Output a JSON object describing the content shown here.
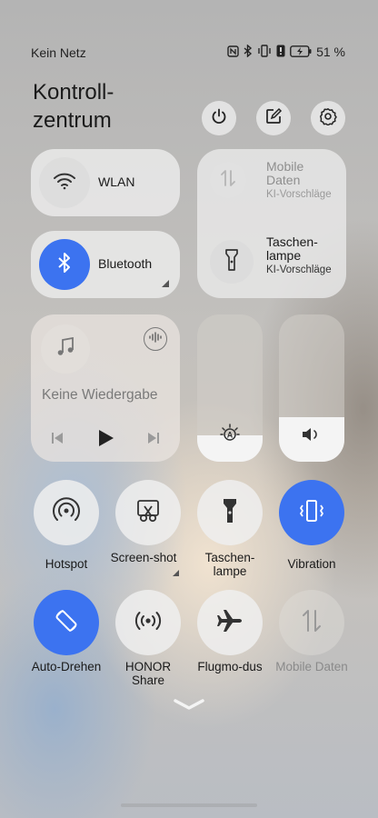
{
  "status_bar": {
    "network": "Kein Netz",
    "battery_percent": "51 %",
    "icons": [
      "nfc-icon",
      "bluetooth-icon",
      "vibrate-icon",
      "alert-icon",
      "battery-icon"
    ]
  },
  "header": {
    "title_line1": "Kontroll-",
    "title_line2": "zentrum",
    "buttons": [
      "power-icon",
      "edit-icon",
      "settings-icon"
    ]
  },
  "wlan": {
    "label": "WLAN"
  },
  "bluetooth": {
    "label": "Bluetooth"
  },
  "mobile_data": {
    "title": "Mobile Daten",
    "subtitle": "KI-Vorschläge"
  },
  "flashlight_tile": {
    "title": "Taschen-lampe",
    "subtitle": "KI-Vorschläge"
  },
  "media": {
    "status": "Keine Wiedergabe"
  },
  "brightness": {
    "level": 0.18
  },
  "volume": {
    "level": 0.3
  },
  "toggles": [
    {
      "label": "Hotspot",
      "icon": "hotspot-icon",
      "active": false
    },
    {
      "label": "Screen-shot",
      "icon": "screenshot-icon",
      "active": false
    },
    {
      "label": "Taschen-lampe",
      "icon": "flashlight-icon",
      "active": false
    },
    {
      "label": "Vibration",
      "icon": "vibration-icon",
      "active": true
    },
    {
      "label": "Auto-Drehen",
      "icon": "auto-rotate-icon",
      "active": true
    },
    {
      "label": "HONOR Share",
      "icon": "honor-share-icon",
      "active": false
    },
    {
      "label": "Flugmo-dus",
      "icon": "airplane-icon",
      "active": false
    },
    {
      "label": "Mobile Daten",
      "icon": "mobile-data-icon",
      "active": false
    }
  ],
  "colors": {
    "accent": "#3c73f0",
    "tile_bg": "#eeeeee"
  }
}
